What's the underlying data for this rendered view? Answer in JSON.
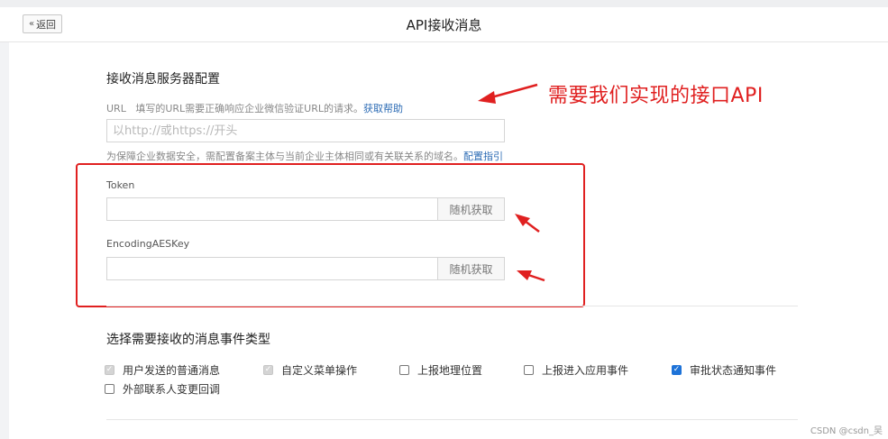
{
  "header": {
    "back_label": "返回",
    "title": "API接收消息"
  },
  "server_config": {
    "title": "接收消息服务器配置",
    "url_label": "URL",
    "url_hint": "填写的URL需要正确响应企业微信验证URL的请求。",
    "url_help_link": "获取帮助",
    "url_placeholder": "以http://或https://开头",
    "domain_hint": "为保障企业数据安全，需配置备案主体与当前企业主体相同或有关联关系的域名。",
    "domain_link": "配置指引",
    "token_label": "Token",
    "token_value": "",
    "aes_label": "EncodingAESKey",
    "aes_value": "",
    "random_button_label": "随机获取"
  },
  "annotation": {
    "text": "需要我们实现的接口API",
    "color": "#e02020"
  },
  "events": {
    "title": "选择需要接收的消息事件类型",
    "items": [
      {
        "label": "用户发送的普通消息",
        "state": "checked-disabled"
      },
      {
        "label": "自定义菜单操作",
        "state": "checked-disabled"
      },
      {
        "label": "上报地理位置",
        "state": "unchecked"
      },
      {
        "label": "上报进入应用事件",
        "state": "unchecked"
      },
      {
        "label": "审批状态通知事件",
        "state": "checked"
      },
      {
        "label": "外部联系人变更回调",
        "state": "unchecked"
      }
    ]
  },
  "watermark": "CSDN @csdn_吴",
  "colors": {
    "accent": "#1e73d8",
    "link": "#2d6cb5",
    "annotation_red": "#e02020"
  },
  "icons": {
    "back": "chevron-double-left-icon",
    "check": "check-icon",
    "arrow": "red-arrow-icon"
  }
}
